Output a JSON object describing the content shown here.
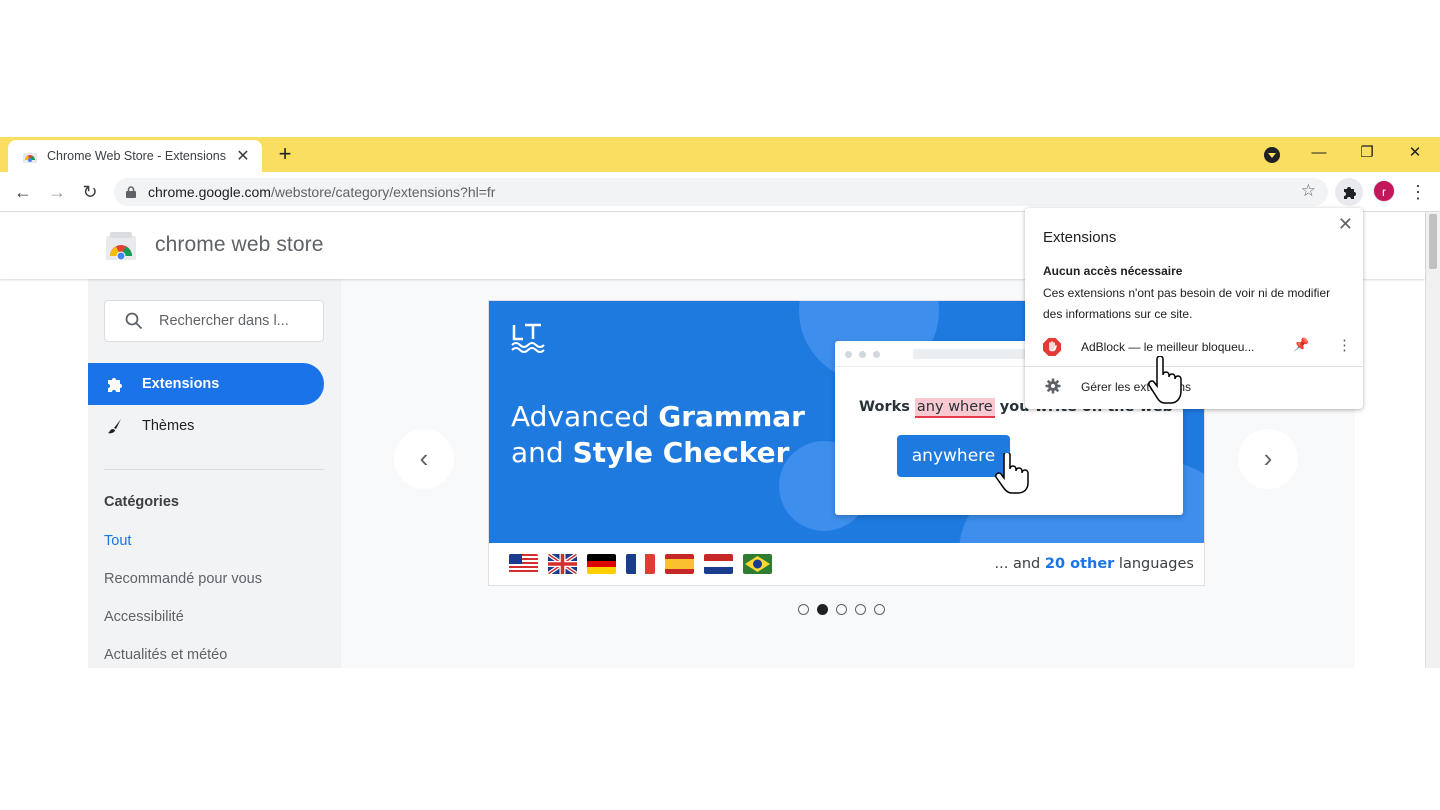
{
  "browser": {
    "tab_title": "Chrome Web Store - Extensions",
    "url_host": "chrome.google.com",
    "url_path": "/webstore/category/extensions?hl=fr",
    "avatar_letter": "r",
    "accent_color": "#f9de5f"
  },
  "store": {
    "title": "chrome web store",
    "search_placeholder": "Rechercher dans l...",
    "nav": [
      {
        "label": "Extensions",
        "icon": "puzzle-icon",
        "active": true
      },
      {
        "label": "Thèmes",
        "icon": "brush-icon",
        "active": false
      }
    ],
    "categories_heading": "Catégories",
    "categories": [
      "Tout",
      "Recommandé pour vous",
      "Accessibilité",
      "Actualités et météo"
    ]
  },
  "banner": {
    "headline_line1_light": "Advanced ",
    "headline_line1_bold": "Grammar",
    "headline_line2_light": "and ",
    "headline_line2_bold": "Style Checker",
    "mock_prefix": "Works ",
    "mock_highlight": "any where",
    "mock_suffix": " you write on the web",
    "suggestion": "anywhere",
    "languages_prefix": "... and ",
    "languages_bold": "20 other",
    "languages_suffix": " languages",
    "flags": [
      "us-flag",
      "uk-flag",
      "de-flag",
      "fr-flag",
      "es-flag",
      "nl-flag",
      "br-flag"
    ],
    "carousel_dots": 5,
    "active_dot": 2
  },
  "extensions_popup": {
    "title": "Extensions",
    "section_title": "Aucun accès nécessaire",
    "section_desc": "Ces extensions n'ont pas besoin de voir ni de modifier des informations sur ce site.",
    "items": [
      {
        "name": "AdBlock — le meilleur bloqueu...",
        "icon": "adblock-icon"
      }
    ],
    "manage_label": "Gérer les extensions"
  }
}
